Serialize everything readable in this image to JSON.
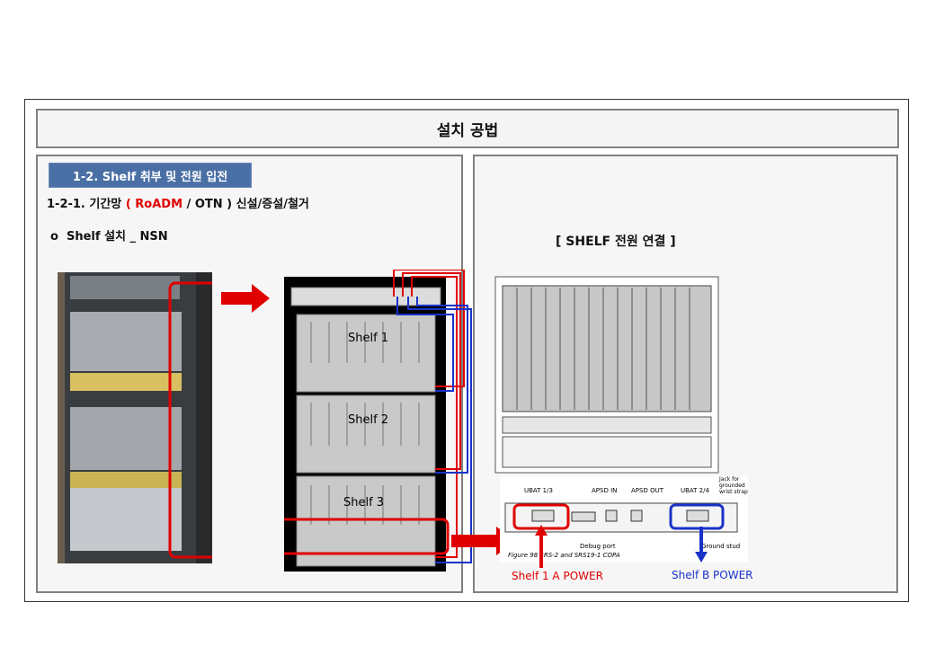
{
  "page_title": "설치 공법",
  "section_label": "1-2. Shelf 취부 및 전원 입전",
  "subtitle": {
    "prefix": "1-2-1. 기간망",
    "paren_open": "(",
    "roadm": "RoADM",
    "slash_otn": "/ OTN )",
    "suffix": "신설/증설/철거"
  },
  "bullet": "o",
  "install_text": "Shelf 설치 _ NSN",
  "connection_title": "[ SHELF 전원 연결 ]",
  "shelves": [
    "Shelf 1",
    "Shelf 2",
    "Shelf 3"
  ],
  "figure": {
    "ubat13": "UBAT 1/3",
    "apsd_in": "APSD IN",
    "apsd_out": "APSD OUT",
    "ubat24": "UBAT 2/4",
    "jack": "Jack for grounded wrist strap",
    "debug": "Debug port",
    "ground": "Ground stud",
    "caption": "Figure 98    SRS-2 and SRS19-1 COPA"
  },
  "power_a": "Shelf 1 A POWER",
  "power_b": "Shelf   B POWER",
  "colors": {
    "accent_red": "#e00000",
    "accent_blue": "#1a32c8",
    "section_bg": "#4a6fa5"
  }
}
